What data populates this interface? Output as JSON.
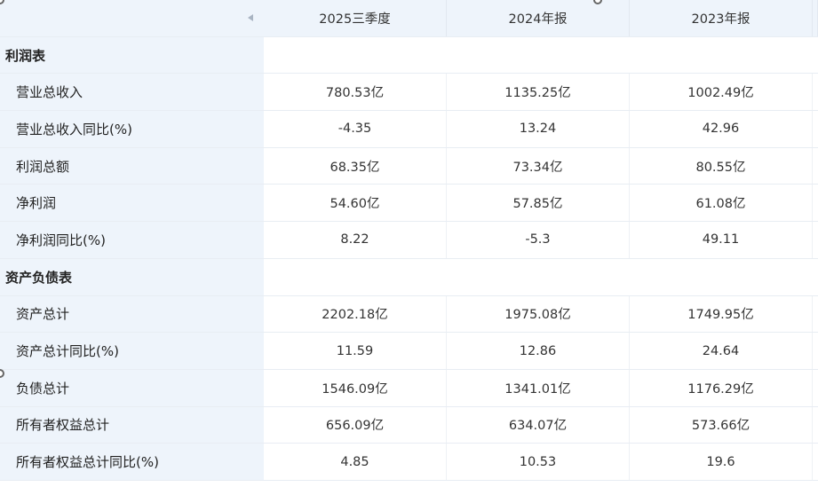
{
  "columns": [
    "2025三季度",
    "2024年报",
    "2023年报"
  ],
  "sections": [
    {
      "title": "利润表",
      "rows": [
        {
          "label": "营业总收入",
          "values": [
            "780.53亿",
            "1135.25亿",
            "1002.49亿"
          ]
        },
        {
          "label": "营业总收入同比(%)",
          "values": [
            "-4.35",
            "13.24",
            "42.96"
          ]
        },
        {
          "label": "利润总额",
          "values": [
            "68.35亿",
            "73.34亿",
            "80.55亿"
          ]
        },
        {
          "label": "净利润",
          "values": [
            "54.60亿",
            "57.85亿",
            "61.08亿"
          ]
        },
        {
          "label": "净利润同比(%)",
          "values": [
            "8.22",
            "-5.3",
            "49.11"
          ]
        }
      ]
    },
    {
      "title": "资产负债表",
      "rows": [
        {
          "label": "资产总计",
          "values": [
            "2202.18亿",
            "1975.08亿",
            "1749.95亿"
          ]
        },
        {
          "label": "资产总计同比(%)",
          "values": [
            "11.59",
            "12.86",
            "24.64"
          ]
        },
        {
          "label": "负债总计",
          "values": [
            "1546.09亿",
            "1341.01亿",
            "1176.29亿"
          ]
        },
        {
          "label": "所有者权益总计",
          "values": [
            "656.09亿",
            "634.07亿",
            "573.66亿"
          ]
        },
        {
          "label": "所有者权益总计同比(%)",
          "values": [
            "4.85",
            "10.53",
            "19.6"
          ]
        }
      ]
    }
  ],
  "icons": {
    "scroll_left": "triangle-left-icon"
  },
  "colors": {
    "label_bg": "#eef4fb",
    "grid": "#e8edf3"
  }
}
